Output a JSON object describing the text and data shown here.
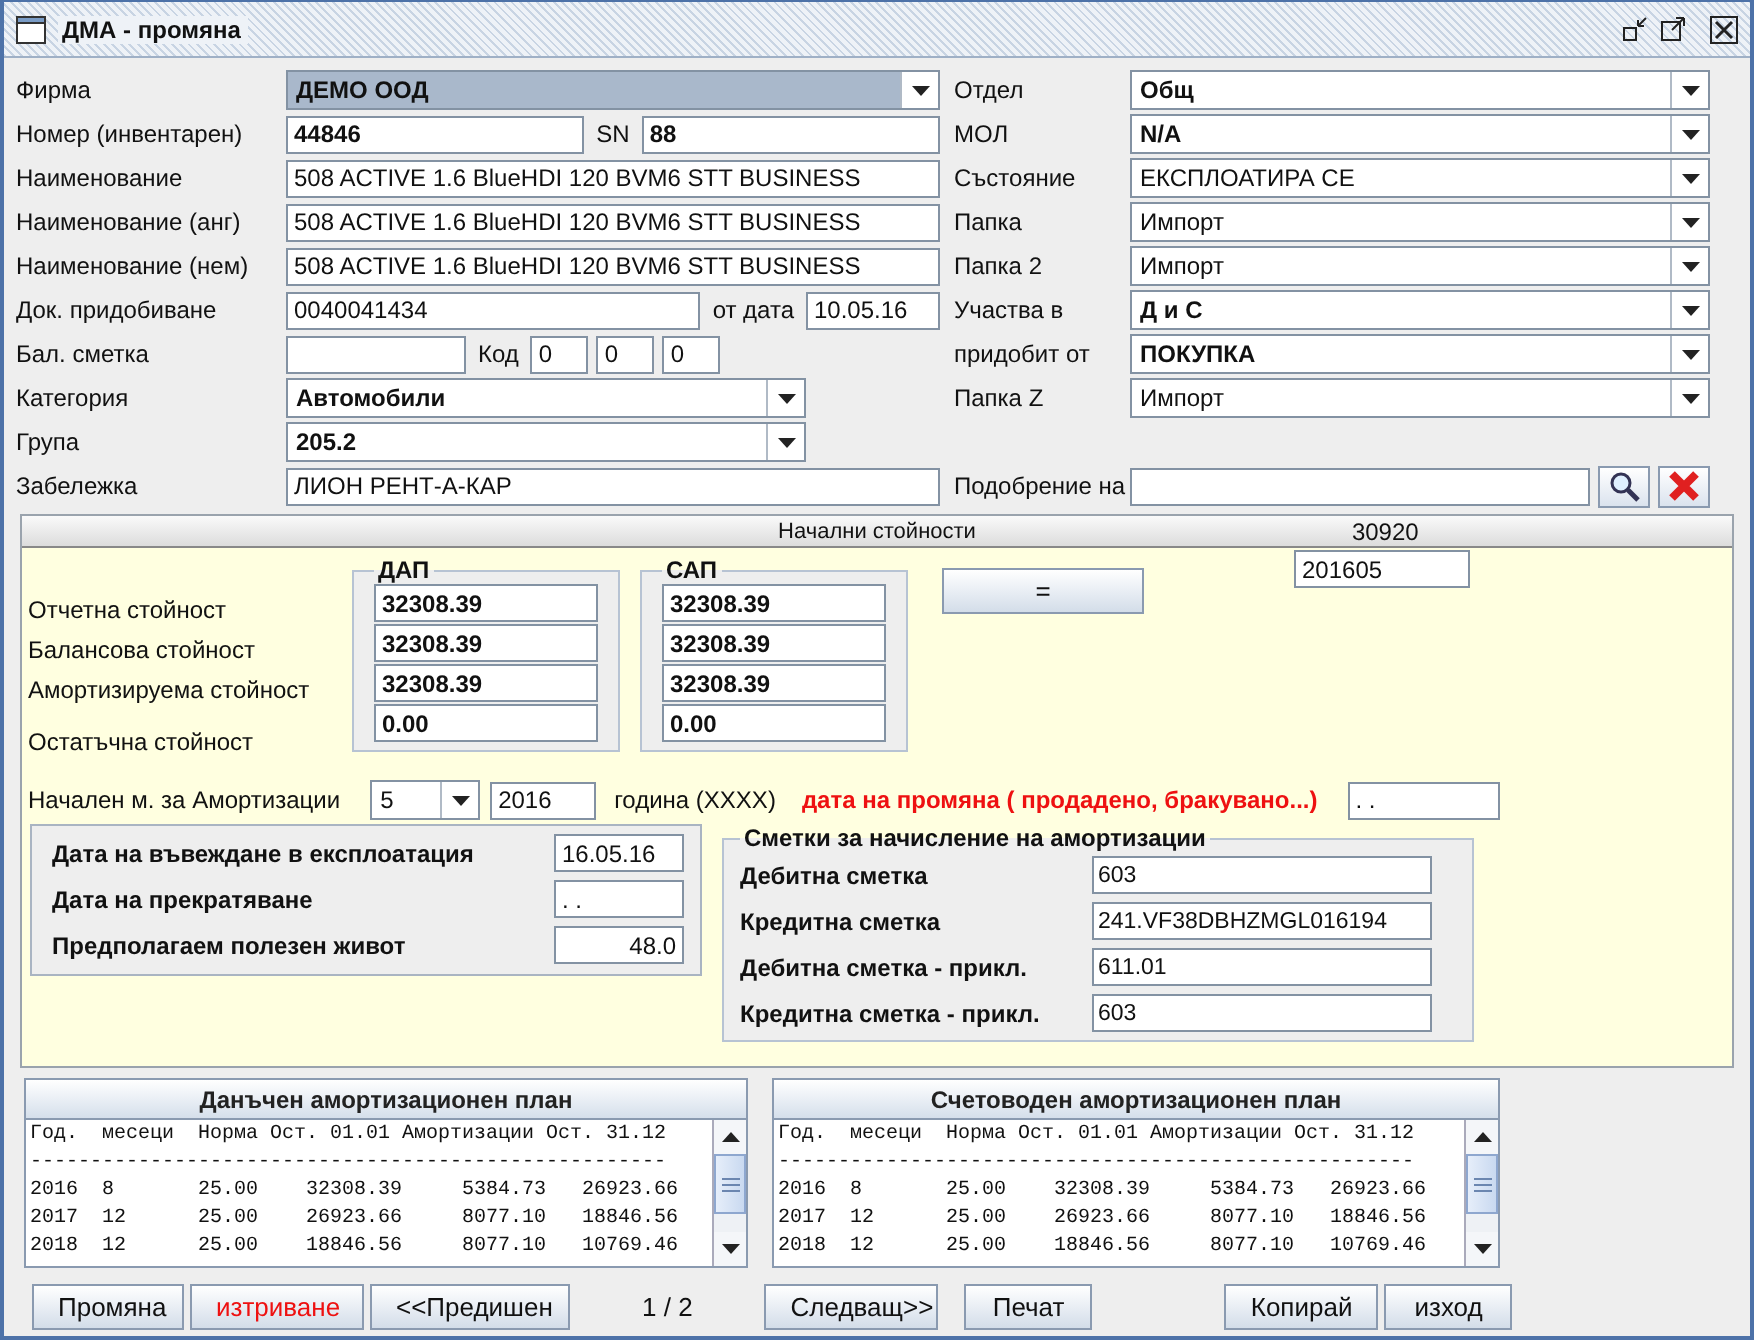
{
  "window": {
    "title": "ДМА - промяна"
  },
  "form_left": [
    {
      "label": "Фирма",
      "controls": [
        {
          "kind": "combo",
          "value": "ДЕМО ООД",
          "bold": true,
          "focused": true
        }
      ]
    },
    {
      "label": "Номер (инвентарен)",
      "controls": [
        {
          "kind": "field",
          "value": "44846",
          "bold": true
        },
        {
          "kind": "caption",
          "text": "SN"
        },
        {
          "kind": "field",
          "value": "88",
          "bold": true
        }
      ]
    },
    {
      "label": "Наименование",
      "controls": [
        {
          "kind": "field",
          "value": "508 ACTIVE 1.6 BlueHDI 120 BVM6 STT BUSINESS",
          "bold": false
        }
      ]
    },
    {
      "label": "Наименование (анг)",
      "controls": [
        {
          "kind": "field",
          "value": "508 ACTIVE 1.6 BlueHDI 120 BVM6 STT BUSINESS",
          "bold": false
        }
      ]
    },
    {
      "label": "Наименование (нем)",
      "controls": [
        {
          "kind": "field",
          "value": "508 ACTIVE 1.6 BlueHDI 120 BVM6 STT BUSINESS",
          "bold": false
        }
      ]
    },
    {
      "label": "Док. придобиване",
      "controls": [
        {
          "kind": "field",
          "value": "0040041434",
          "bold": false
        },
        {
          "kind": "caption",
          "text": "от дата"
        },
        {
          "kind": "datefield",
          "value": "10.05.16",
          "bold": false
        }
      ]
    },
    {
      "label": "Бал. сметка",
      "controls": [
        {
          "kind": "shortfield"
        },
        {
          "kind": "caption",
          "text": "Код"
        },
        {
          "kind": "codefield",
          "value": "0",
          "bold": false
        },
        {
          "kind": "codefield",
          "value": "0",
          "bold": false
        },
        {
          "kind": "codefield",
          "value": "0",
          "bold": false
        }
      ]
    },
    {
      "label": "Категория",
      "controls": [
        {
          "kind": "medcombo",
          "value": "Автомобили",
          "bold": true,
          "focused": false
        }
      ]
    },
    {
      "label": "Група",
      "controls": [
        {
          "kind": "medcombo",
          "value": "205.2",
          "bold": true,
          "focused": false
        }
      ]
    },
    {
      "label": "Забележка",
      "controls": [
        {
          "kind": "field",
          "value": "ЛИОН РЕНТ-А-КАР",
          "bold": false
        }
      ]
    }
  ],
  "form_right": [
    {
      "label": "Отдел",
      "controls": [
        {
          "kind": "combo",
          "value": "Общ",
          "bold": true,
          "focused": false
        }
      ]
    },
    {
      "label": "МОЛ",
      "controls": [
        {
          "kind": "combo",
          "value": "N/A",
          "bold": true,
          "focused": false
        }
      ]
    },
    {
      "label": "Състояние",
      "controls": [
        {
          "kind": "combo",
          "value": "ЕКСПЛОАТИРА СЕ",
          "bold": false,
          "focused": false
        }
      ]
    },
    {
      "label": "Папка",
      "controls": [
        {
          "kind": "combo",
          "value": "Импорт",
          "bold": false,
          "focused": false
        }
      ]
    },
    {
      "label": "Папка 2",
      "controls": [
        {
          "kind": "combo",
          "value": "Импорт",
          "bold": false,
          "focused": false
        }
      ]
    },
    {
      "label": "Участва в",
      "controls": [
        {
          "kind": "combo",
          "value": "Д и С",
          "bold": true,
          "focused": false
        }
      ]
    },
    {
      "label": "придобит от",
      "controls": [
        {
          "kind": "combo",
          "value": "ПОКУПКА",
          "bold": true,
          "focused": false
        }
      ]
    },
    {
      "label": "Папка Z",
      "controls": [
        {
          "kind": "combo",
          "value": "Импорт",
          "bold": false,
          "focused": false
        }
      ]
    },
    {
      "label": "Подобрение на",
      "controls": [
        {
          "kind": "field"
        },
        {
          "kind": "search"
        },
        {
          "kind": "delete"
        }
      ]
    }
  ],
  "initial": {
    "title": "Начални стойности",
    "number": "30920",
    "row_labels": [
      "Отчетна стойност",
      "Балансова стойност",
      "Амортизируема стойност",
      "Остатъчна стойност"
    ],
    "groups": [
      {
        "title": "ДАП",
        "values": [
          "32308.39",
          "32308.39",
          "32308.39",
          "0.00"
        ]
      },
      {
        "title": "САП",
        "values": [
          "32308.39",
          "32308.39",
          "32308.39",
          "0.00"
        ]
      }
    ],
    "equals_button": "=",
    "period": "201605",
    "start": {
      "label": "Начален м. за Амортизации",
      "month": "5",
      "year": "2016",
      "year_hint": "година (XXXX)",
      "change_label": "дата на промяна ( продадено, бракувано...)",
      "change_date": ". ."
    },
    "dates": [
      {
        "label": "Дата на въвеждане в експлоатация",
        "value": "16.05.16",
        "kind": "date"
      },
      {
        "label": "Дата на прекратяване",
        "value": ". .",
        "kind": "date"
      },
      {
        "label": "Предполагаем полезен живот",
        "value": "48.0",
        "kind": "number"
      }
    ],
    "accounts": {
      "title": "Сметки за начисление на амортизации",
      "rows": [
        {
          "label": "Дебитна сметка",
          "value": "603"
        },
        {
          "label": "Кредитна сметка",
          "value": "241.VF38DBHZMGL016194"
        },
        {
          "label": "Дебитна сметка - прикл.",
          "value": "611.01"
        },
        {
          "label": "Кредитна сметка - прикл.",
          "value": "603"
        }
      ]
    }
  },
  "plans": [
    {
      "title": "Данъчен амортизационен план",
      "columns": [
        "Год.",
        "месеци",
        "Норма",
        "Ост. 01.01",
        "Амортизации",
        "Ост. 31.12"
      ],
      "separator": "-----------------------------------------------------",
      "rows": [
        [
          "2016",
          "8",
          "25.00",
          "32308.39",
          "5384.73",
          "26923.66"
        ],
        [
          "2017",
          "12",
          "25.00",
          "26923.66",
          "8077.10",
          "18846.56"
        ],
        [
          "2018",
          "12",
          "25.00",
          "18846.56",
          "8077.10",
          "10769.46"
        ]
      ]
    },
    {
      "title": "Счетоводен амортизационен план",
      "columns": [
        "Год.",
        "месеци",
        "Норма",
        "Ост. 01.01",
        "Амортизации",
        "Ост. 31.12"
      ],
      "separator": "-----------------------------------------------------",
      "rows": [
        [
          "2016",
          "8",
          "25.00",
          "32308.39",
          "5384.73",
          "26923.66"
        ],
        [
          "2017",
          "12",
          "25.00",
          "26923.66",
          "8077.10",
          "18846.56"
        ],
        [
          "2018",
          "12",
          "25.00",
          "18846.56",
          "8077.10",
          "10769.46"
        ]
      ]
    }
  ],
  "buttons": [
    {
      "label": "Промяна",
      "kind": "normal"
    },
    {
      "label": "изтриване",
      "kind": "danger"
    },
    {
      "label": "<<Предишен",
      "kind": "normal"
    },
    {
      "label": "1 / 2",
      "kind": "counter"
    },
    {
      "label": "Следващ>>",
      "kind": "normal"
    },
    {
      "label": "Печат",
      "kind": "normal"
    },
    {
      "label": "Копирай",
      "kind": "normal"
    },
    {
      "label": "изход",
      "kind": "normal"
    }
  ]
}
